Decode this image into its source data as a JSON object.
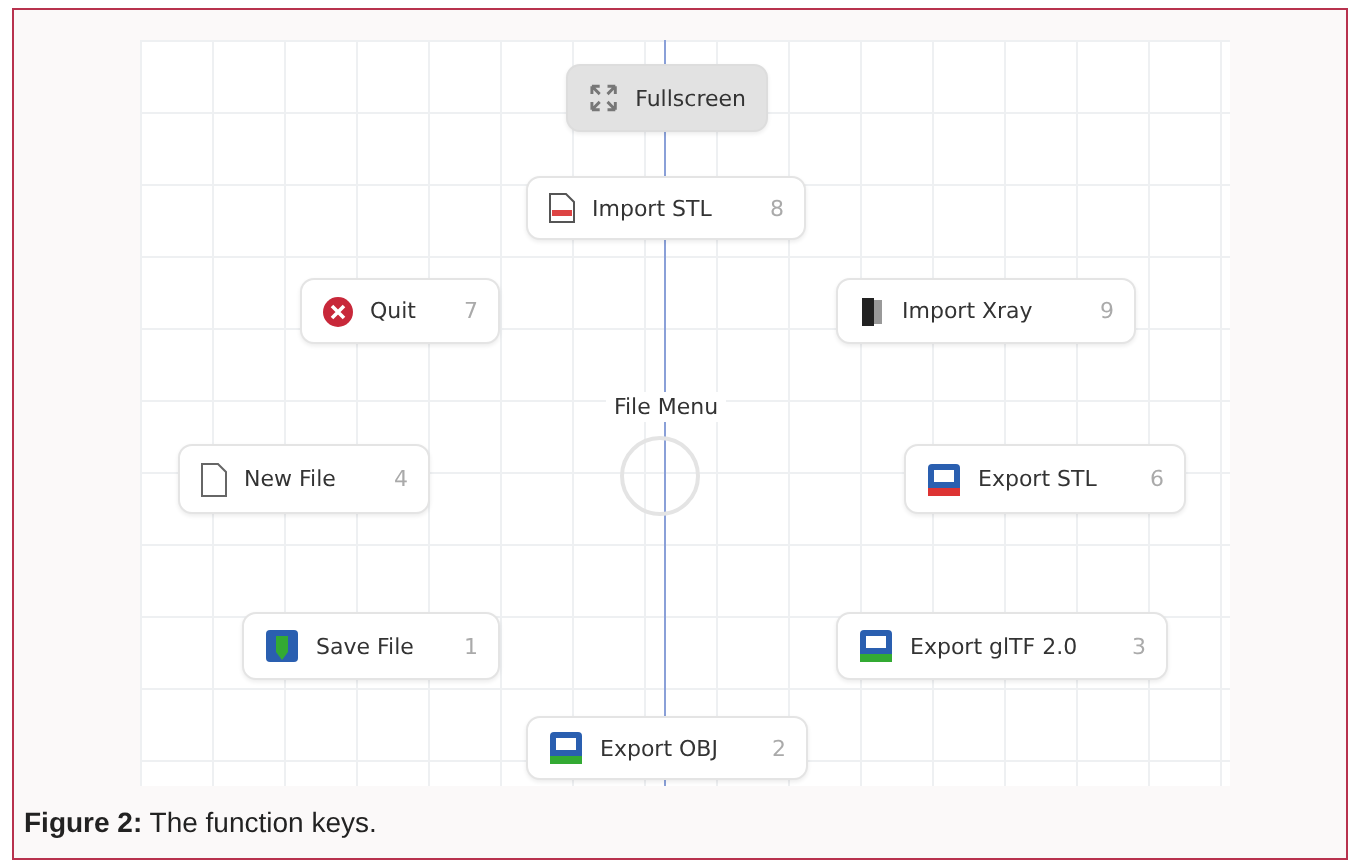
{
  "pie_menu": {
    "title": "File Menu",
    "items": [
      {
        "label": "Fullscreen",
        "selected": true
      },
      {
        "label": "Import STL",
        "hotkey": "8",
        "selected": false
      },
      {
        "label": "Quit",
        "hotkey": "7",
        "selected": false
      },
      {
        "label": "Import Xray",
        "hotkey": "9",
        "selected": false
      },
      {
        "label": "New File",
        "hotkey": "4",
        "selected": false
      },
      {
        "label": "Export STL",
        "hotkey": "6",
        "selected": false
      },
      {
        "label": "Save File",
        "hotkey": "1",
        "selected": false
      },
      {
        "label": "Export glTF 2.0",
        "hotkey": "3",
        "selected": false
      },
      {
        "label": "Export OBJ",
        "hotkey": "2",
        "selected": false
      }
    ]
  },
  "caption": "**Figure 2:** The function keys."
}
